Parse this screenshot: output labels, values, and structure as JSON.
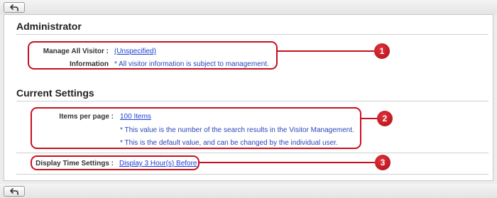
{
  "back_icon": "back-arrow-icon",
  "administrator": {
    "title": "Administrator",
    "manage_label": "Manage All Visitor :",
    "manage_value": "(Unspecified)",
    "info_label": "Information",
    "info_note": "* All visitor information is subject to management.",
    "badge": "1"
  },
  "current_settings": {
    "title": "Current Settings",
    "items_label": "Items per page :",
    "items_value": "100 Items",
    "note1": "* This value is the number of the search results in the Visitor Management.",
    "note2": "* This is the default value, and can be changed by the individual user.",
    "badge": "2",
    "display_label": "Display Time Settings :",
    "display_value": "Display 3 Hour(s) Before",
    "badge3": "3"
  },
  "colors": {
    "callout": "#c8101e",
    "link": "#1a3fd6"
  }
}
